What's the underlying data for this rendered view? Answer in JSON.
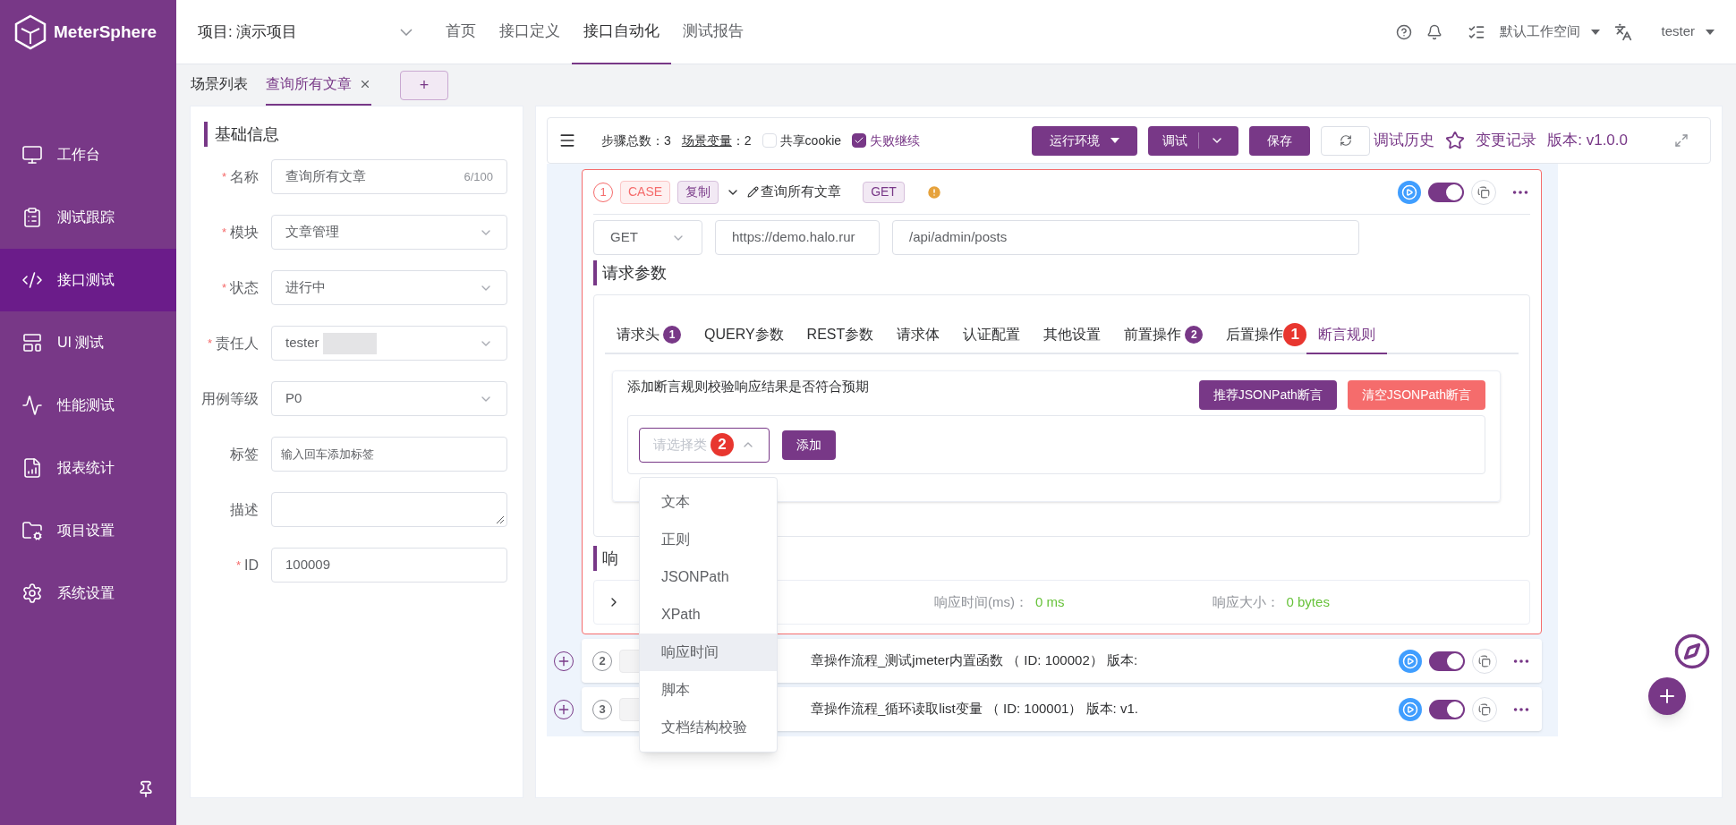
{
  "logo": "MeterSphere",
  "sidebar": {
    "items": [
      {
        "label": "工作台",
        "selected": false
      },
      {
        "label": "测试跟踪",
        "selected": false
      },
      {
        "label": "接口测试",
        "selected": true
      },
      {
        "label": "UI 测试",
        "selected": false
      },
      {
        "label": "性能测试",
        "selected": false
      },
      {
        "label": "报表统计",
        "selected": false
      },
      {
        "label": "项目设置",
        "selected": false
      },
      {
        "label": "系统设置",
        "selected": false
      }
    ]
  },
  "topbar": {
    "project": "项目: 演示项目",
    "nav": [
      {
        "label": "首页",
        "selected": false
      },
      {
        "label": "接口定义",
        "selected": false
      },
      {
        "label": "接口自动化",
        "selected": true
      },
      {
        "label": "测试报告",
        "selected": false
      }
    ],
    "workspace": "默认工作空间",
    "user": "tester"
  },
  "scene_tabs": {
    "list_label": "场景列表",
    "tabs": [
      {
        "label": "查询所有文章",
        "selected": true
      }
    ],
    "add": "+"
  },
  "basic_info": {
    "title": "基础信息",
    "required_mark": "*",
    "fields": [
      {
        "label": "名称",
        "required": true,
        "kind": "text",
        "value": "查询所有文章",
        "counter": "6/100"
      },
      {
        "label": "模块",
        "required": true,
        "kind": "select",
        "value": "文章管理"
      },
      {
        "label": "状态",
        "required": true,
        "kind": "select",
        "value": "进行中"
      },
      {
        "label": "责任人",
        "required": true,
        "kind": "select",
        "value": "tester",
        "redacted": true
      },
      {
        "label": "用例等级",
        "required": false,
        "kind": "select",
        "value": "P0"
      },
      {
        "label": "标签",
        "required": false,
        "kind": "text",
        "placeholder": "输入回车添加标签"
      },
      {
        "label": "描述",
        "required": false,
        "kind": "textarea"
      },
      {
        "label": "ID",
        "required": true,
        "kind": "text",
        "value": "100009"
      }
    ]
  },
  "toolbar": {
    "step_total": "步骤总数：3",
    "scene_var_label": "场景变量",
    "scene_var": "：2",
    "share_cookie": {
      "label": "共享cookie",
      "checked": false
    },
    "fail_continue": {
      "label": "失败继续",
      "checked": true
    },
    "env": "运行环境",
    "debug": "调试",
    "save": "保存",
    "history": "调试历史",
    "changes": "变更记录",
    "version": "版本: v1.0.0"
  },
  "step": {
    "number": "1",
    "tags": [
      "CASE",
      "复制"
    ],
    "name": "查询所有文章",
    "method_tag": "GET",
    "enabled": true,
    "method": "GET",
    "domain": "https://demo.halo.rur",
    "path": "/api/admin/posts",
    "section_title": "请求参数",
    "tabs": [
      {
        "label": "请求头",
        "count": "1",
        "selected": false
      },
      {
        "label": "QUERY参数",
        "selected": false
      },
      {
        "label": "REST参数",
        "selected": false
      },
      {
        "label": "请求体",
        "selected": false
      },
      {
        "label": "认证配置",
        "selected": false
      },
      {
        "label": "其他设置",
        "selected": false
      },
      {
        "label": "前置操作",
        "count": "2",
        "selected": false
      },
      {
        "label": "后置操作",
        "marker": "1",
        "selected": false
      },
      {
        "label": "断言规则",
        "selected": true
      }
    ],
    "assert": {
      "hint": "添加断言规则校验响应结果是否符合预期",
      "recommend": "推荐JSONPath断言",
      "clear": "清空JSONPath断言",
      "placeholder": "请选择类",
      "marker": "2",
      "add": "添加",
      "options": [
        {
          "label": "文本",
          "selected": false
        },
        {
          "label": "正则",
          "selected": false
        },
        {
          "label": "JSONPath",
          "selected": false
        },
        {
          "label": "XPath",
          "selected": false
        },
        {
          "label": "响应时间",
          "selected": true
        },
        {
          "label": "脚本",
          "selected": false
        },
        {
          "label": "文档结构校验",
          "selected": false
        }
      ]
    },
    "response_title": "响",
    "response_time_label": "响应时间(ms)：",
    "response_time": "0 ms",
    "response_size_label": "响应大小：",
    "response_size": "0 bytes"
  },
  "other_steps": [
    {
      "number": "2",
      "text": "章操作流程_测试jmeter内置函数 （ ID: 100002） 版本:",
      "enabled": true
    },
    {
      "number": "3",
      "text": "章操作流程_循环读取list变量 （ ID: 100001） 版本: v1.",
      "enabled": true
    }
  ]
}
